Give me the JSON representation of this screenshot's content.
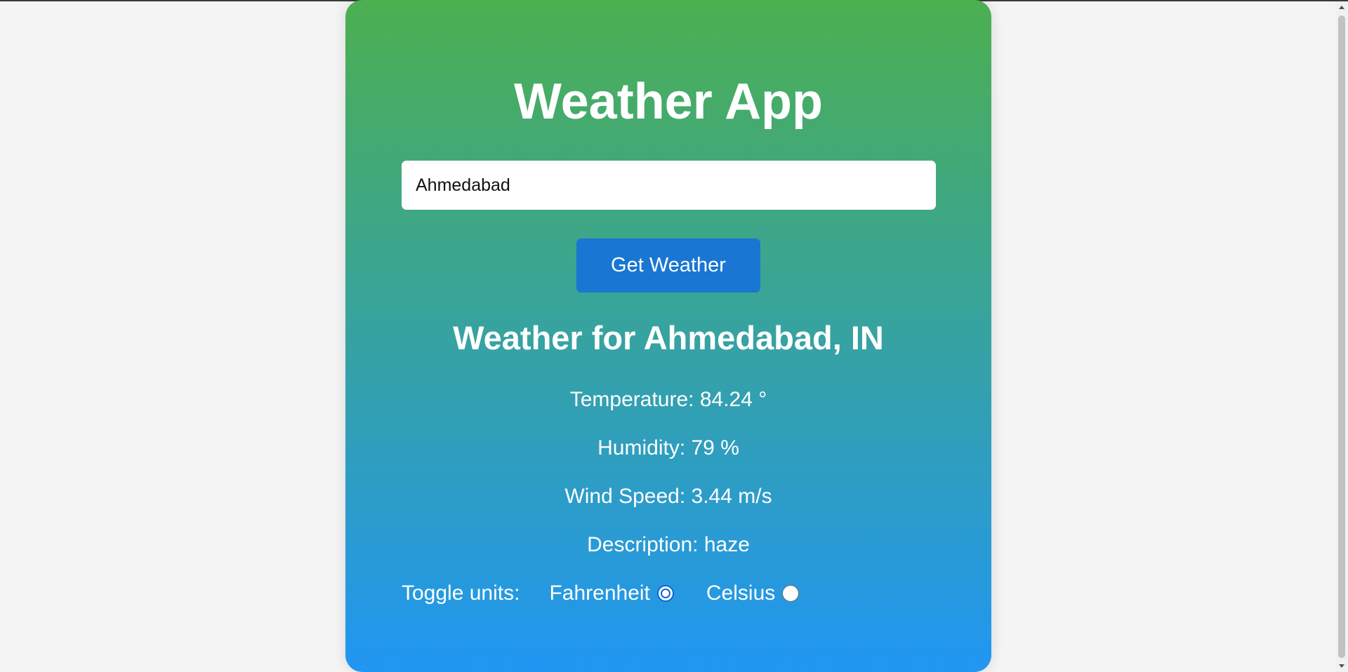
{
  "app": {
    "title": "Weather App"
  },
  "search": {
    "value": "Ahmedabad",
    "button_label": "Get Weather"
  },
  "result": {
    "heading": "Weather for Ahmedabad, IN",
    "temperature": "Temperature: 84.24 °",
    "humidity": "Humidity: 79 %",
    "wind_speed": "Wind Speed: 3.44 m/s",
    "description": "Description: haze"
  },
  "units": {
    "label": "Toggle units:",
    "options": [
      {
        "label": "Fahrenheit",
        "selected": true
      },
      {
        "label": "Celsius",
        "selected": false
      }
    ]
  },
  "colors": {
    "gradient_top": "#4caf50",
    "gradient_bottom": "#2196f3",
    "button": "#1976d2",
    "page_background": "#f4f4f4"
  }
}
